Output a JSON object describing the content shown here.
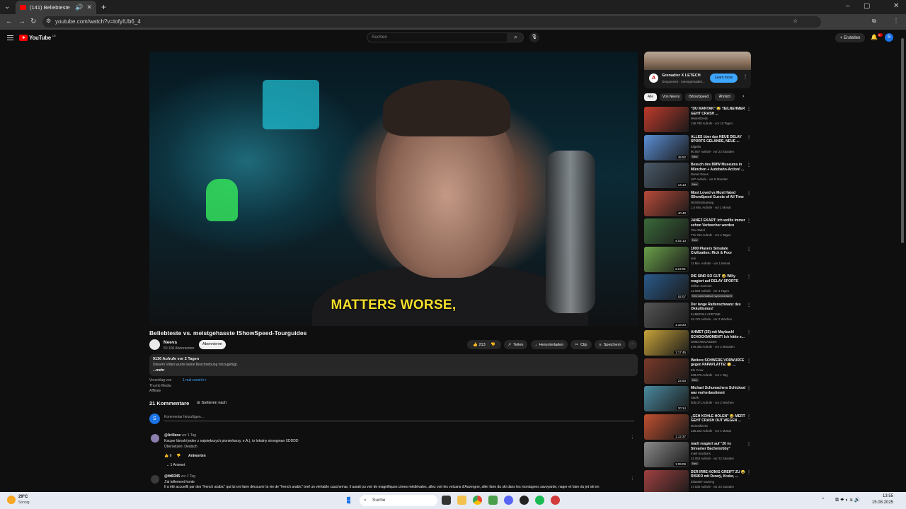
{
  "browser": {
    "tab_title": "(141) Beliebteste vs. meistg",
    "url": "youtube.com/watch?v=tofyIUb6_4"
  },
  "header": {
    "logo_text": "YouTube",
    "logo_country": "DE",
    "search_placeholder": "Suchen",
    "create_label": "Erstellen",
    "notification_count": "9+",
    "avatar_letter": "S"
  },
  "video": {
    "subtitle": "MATTERS WORSE,",
    "title": "Beliebteste vs. meistgehasste IShowSpeed-Tourguides",
    "channel": "Neevs",
    "subscribers": "50.100 Abonnenten",
    "subscribe_label": "Abonnieren",
    "likes": "213",
    "share_label": "Teilen",
    "download_label": "Herunterladen",
    "clip_label": "Clip",
    "save_label": "Speichern"
  },
  "description": {
    "views_date": "9130 Aufrufe  vor 2 Tagen",
    "text": "Diesem Video wurde keine Beschreibung hinzugefügt.",
    "more": "...mehr"
  },
  "suggestion": {
    "label": "Vorschlag von",
    "items": [
      "Thumb Media",
      "Affiliate"
    ],
    "link": "1 mal conshl++"
  },
  "comments": {
    "count_label": "21 Kommentare",
    "sort_label": "Sortieren nach",
    "my_avatar": "S",
    "add_placeholder": "Kommentar hinzufügen...",
    "items": [
      {
        "author": "@Arillene",
        "time": "vor 1 Tag",
        "text": "Kacper biroski jeden z największych pionierkarzy, e.A.), to lokalny strongman XDDDD",
        "translate": "Übersetzen: Deutsch",
        "likes": "6",
        "reply_label": "Antworten",
        "replies": "1 Antwort"
      },
      {
        "author": "@Itt6I345",
        "time": "vor 1 Tag",
        "text": "J'ai tellement honte",
        "text2": "Il a été accueilli par des \"french arabic\" qui lui ont faire découvrir la vie de \"french arabic\" bref un véritable cauchemar, il aurait pu voir de magnifiques cimes médiévales, allez voir les volcans d'Auvergne, aller faire du ski dans les montagnes savoyarde, nager et faire du jet ski en"
      }
    ]
  },
  "ad": {
    "title": "Grenadier X LETECH",
    "sponsor": "Gesponsert · Ineosgrenadier...",
    "learn_more": "Learn more"
  },
  "chips": [
    "Alle",
    "Von Neevs",
    "IShowSpeed",
    "Ähnlich"
  ],
  "recommendations": [
    {
      "title": "\"DU MANYAK\" 😂 TEILNEHMER GEHT CRASH ...",
      "channel": "MeinKillzeits",
      "meta": "126.790 Aufrufe · vor 10 Tagen",
      "duration": "",
      "badge": ""
    },
    {
      "title": "ALLES über das NEUE DELAY SPORTS GELÄNDE, NEUE ...",
      "channel": "Eligella",
      "meta": "90.567 Aufrufe · vor 23 Stunden",
      "duration": "45:52",
      "badge": "Neu"
    },
    {
      "title": "Besuch des BMW Museums in München + Autobahn-Action! ...",
      "channel": "Daniel Drees",
      "meta": "167 Aufrufe · vor 5 Stunden",
      "duration": "14:13",
      "badge": "Neu"
    },
    {
      "title": "Most Loved vs Most Hated IShowSpeed Guests of All Time",
      "channel": "MONOstreaming",
      "meta": "1,5 Mio. Aufrufe · vor 1 Monat",
      "duration": "40:48",
      "badge": ""
    },
    {
      "title": "JANEZ EKART: Ich wollte immer schon Verbrecher werden",
      "channel": "Tim Gabel",
      "meta": "771.752 Aufrufe · vor 4 Tagen",
      "duration": "4:02:13",
      "badge": "Neu"
    },
    {
      "title": "1000 Players Simulate Civilization: Rich & Poor",
      "channel": "sub",
      "meta": "11 Mio. Aufrufe · vor 1 Monat",
      "duration": "2:24:01",
      "badge": ""
    },
    {
      "title": "DIE SIND SO GUT 😂 Willy reagiert auf DELAY SPORTS vs...",
      "channel": "Willius Sommer",
      "meta": "14.583 Aufrufe · vor 4 Tagen",
      "duration": "52:07",
      "badge": "Neu  Automatisch synchronisiert"
    },
    {
      "title": "Der lange Rattenschwanz des Okkultismus!",
      "channel": "KAMERSH LIFETIME",
      "meta": "42.175 Aufrufe · vor 2 Wochen",
      "duration": "1:18:23",
      "badge": ""
    },
    {
      "title": "AHMET (25) mit Maybach! SCHOCKMOMENT! Ich hätte e...",
      "channel": "OMID MOUAZZEN",
      "meta": "276.386 Aufrufe · vor 2 Monaten",
      "duration": "1:17:45",
      "badge": ""
    },
    {
      "title": "Weitere SCHWERE VORWÜRFE gegen PAPAPLATTE! 😳 ...",
      "channel": "Ele Crow",
      "meta": "238.675 Aufrufe · vor 1 Tag",
      "duration": "22:53",
      "badge": "Neu"
    },
    {
      "title": "Michael Schumachers Schicksal war vorherbestimmt",
      "channel": "Starik",
      "meta": "505.071 Aufrufe · vor 2 Wochen",
      "duration": "20:14",
      "badge": ""
    },
    {
      "title": "„GEH KOHLE HOLEN\" 😂 MERT GEHT CRASH OUT WEGEN ...",
      "channel": "MeinKillzeits",
      "meta": "125.222 Aufrufe · vor 1 Monat",
      "duration": "1:12:37",
      "badge": ""
    },
    {
      "title": "marli reagiert auf \"20 vs Streamer Bachelorbby\"",
      "channel": "marli reactions",
      "meta": "21.053 Aufrufe · vor 22 Stunden",
      "duration": "1:09:09",
      "badge": "Neu"
    },
    {
      "title": "DER IRRE KÖNIG GREIFT ZU 😂 RISIKO mit Dennÿ, Kroko, ...",
      "channel": "Eliaa997 Gaming",
      "meta": "17.830 Aufrufe · vor 23 Stunden",
      "duration": "",
      "badge": ""
    }
  ],
  "taskbar": {
    "weather_temp": "29°C",
    "weather_desc": "Sonnig",
    "search_label": "Suche",
    "time": "13:55",
    "date": "15.08.2025"
  },
  "colors": {
    "accent_red": "#ff0000",
    "link_blue": "#3ea6ff",
    "subtitle_yellow": "#f6df2a"
  }
}
